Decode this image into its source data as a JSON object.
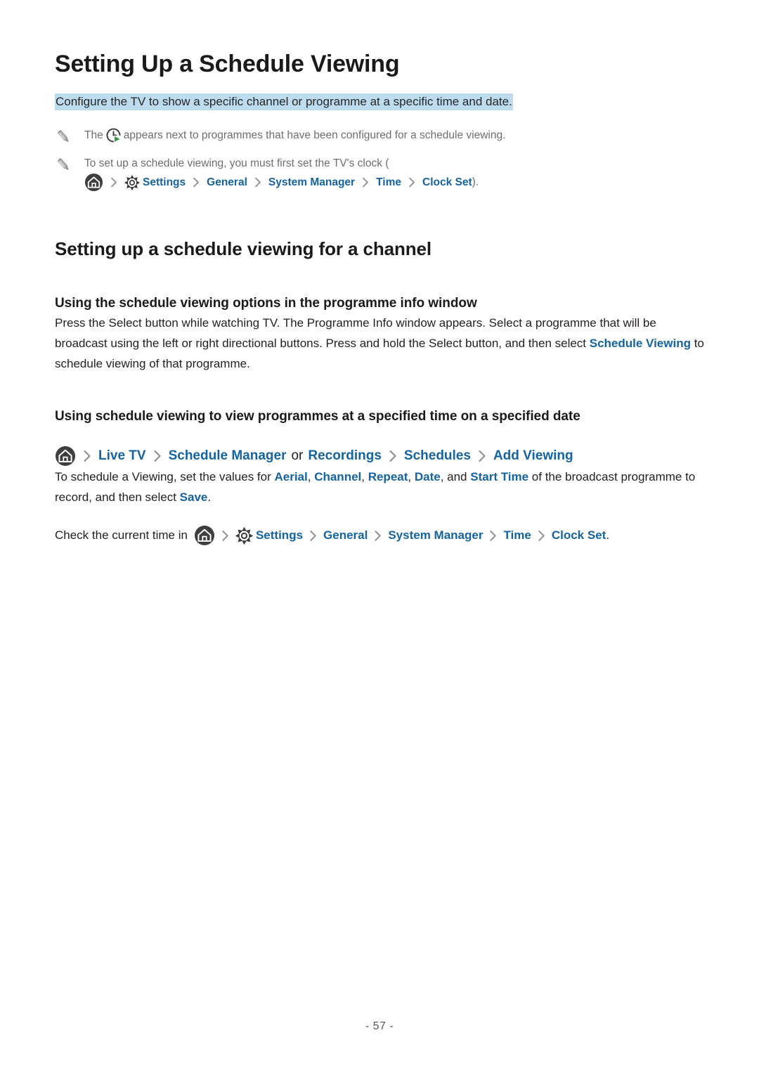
{
  "document": {
    "title": "Setting Up a Schedule Viewing",
    "lead": "Configure the TV to show a specific channel or programme at a specific time and date.",
    "page_number": "- 57 -",
    "highlight_color": "#bedcf0",
    "link_color": "#15639f",
    "note_text_color": "#6e6e73"
  },
  "notes": [
    {
      "icon": "pencil-icon",
      "text_before": "The",
      "inline_icon": "clock-schedule-icon",
      "text_after": "appears next to programmes that have been configured for a schedule viewing."
    },
    {
      "icon": "pencil-icon",
      "text_before": "To set up a schedule viewing, you must first set the TV's clock (",
      "home_icon": "home-icon",
      "gear_icon": "gear-icon",
      "crumbs": [
        "Settings",
        "General",
        "System Manager",
        "Time",
        "Clock Set"
      ],
      "text_after": ")."
    }
  ],
  "section": {
    "title": "Setting up a schedule viewing for a channel"
  },
  "subsection_1": {
    "title": "Using the schedule viewing options in the programme info window",
    "paragraph": {
      "part_1": "Press the Select button while watching TV. The Programme Info window appears. Select a programme that will be broadcast using the left or right directional buttons. Press and hold the Select button, and then select ",
      "link": "Schedule Viewing",
      "part_2": " to schedule viewing of that programme."
    }
  },
  "subsection_2": {
    "title": "Using schedule viewing to view programmes at a specified time on a specified date",
    "breadcrumb": {
      "home_icon": "home-icon",
      "items": [
        "Live TV",
        "Schedule Manager",
        "Recordings",
        "Schedules",
        "Add Viewing"
      ],
      "conjunction": "or"
    },
    "paragraph": {
      "part_1": "To schedule a Viewing, set the values for ",
      "link_1": "Aerial",
      "sep_1": ", ",
      "link_2": "Channel",
      "sep_2": ", ",
      "link_3": "Repeat",
      "sep_3": ", ",
      "link_4": "Date",
      "sep_4": ", and ",
      "link_5": "Start Time",
      "part_2": " of the broadcast programme to record, and then select ",
      "link_6": "Save",
      "part_3": "."
    },
    "check_time": {
      "text_before": "Check the current time in",
      "home_icon": "home-icon",
      "gear_icon": "gear-icon",
      "crumbs": [
        "Settings",
        "General",
        "System Manager",
        "Time",
        "Clock Set"
      ],
      "text_after": "."
    }
  }
}
